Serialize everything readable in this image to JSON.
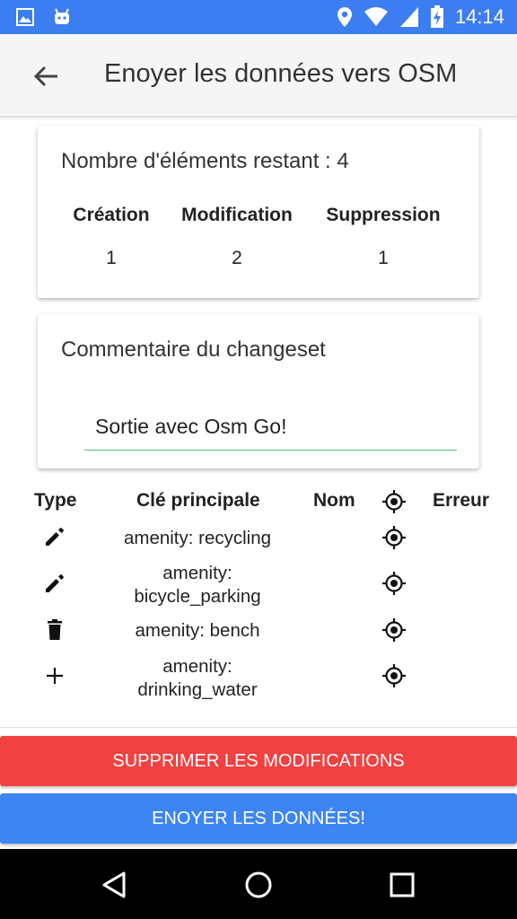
{
  "status_bar": {
    "time": "14:14",
    "icons": [
      "image-icon",
      "android-icon",
      "location-icon",
      "wifi-icon",
      "signal-icon",
      "battery-charging-icon"
    ],
    "color": "#3c7df2"
  },
  "app_bar": {
    "title": "Enoyer les données vers OSM",
    "back_icon": "arrow-back-icon"
  },
  "summary": {
    "remaining_label": "Nombre d'éléments restant : 4",
    "columns": [
      {
        "header": "Création",
        "value": "1"
      },
      {
        "header": "Modification",
        "value": "2"
      },
      {
        "header": "Suppression",
        "value": "1"
      }
    ]
  },
  "changeset": {
    "label": "Commentaire du changeset",
    "value": "Sortie avec Osm Go!",
    "underline_color": "#4ec27a"
  },
  "table": {
    "headers": {
      "type": "Type",
      "key": "Clé principale",
      "name": "Nom",
      "target_icon": "target-icon",
      "error": "Erreur"
    },
    "rows": [
      {
        "type_icon": "pencil-icon",
        "key": "amenity: recycling",
        "name": "",
        "error": ""
      },
      {
        "type_icon": "pencil-icon",
        "key": "amenity: bicycle_parking",
        "key_line1": "amenity:",
        "key_line2": "bicycle_parking",
        "name": "",
        "error": ""
      },
      {
        "type_icon": "trash-icon",
        "key": "amenity: bench",
        "name": "",
        "error": ""
      },
      {
        "type_icon": "plus-icon",
        "key": "amenity: drinking_water",
        "key_line1": "amenity:",
        "key_line2": "drinking_water",
        "name": "",
        "error": ""
      }
    ]
  },
  "buttons": {
    "delete": {
      "label": "SUPPRIMER LES MODIFICATIONS",
      "color": "#f24141"
    },
    "send": {
      "label": "ENOYER LES DONNÉES!",
      "color": "#3c85f2"
    }
  },
  "nav_bar": {
    "icons": [
      "back-triangle-icon",
      "home-circle-icon",
      "recents-square-icon"
    ]
  }
}
